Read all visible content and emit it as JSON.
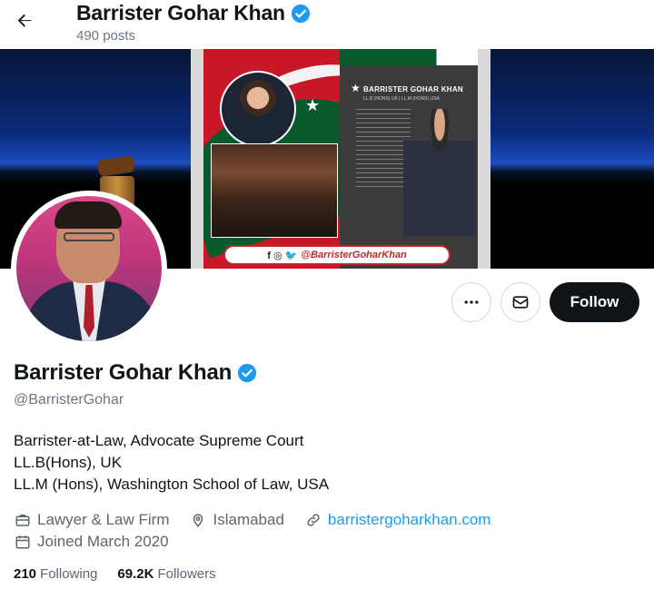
{
  "header": {
    "name": "Barrister Gohar Khan",
    "posts": "490 posts"
  },
  "banner": {
    "magazine_title": "BARRISTER GOHAR KHAN",
    "magazine_subtitle": "LL.B (HONS) UK | LL.M (HONS) USA",
    "handle_pill": "@BarristerGoharKhan"
  },
  "actions": {
    "more_label": "•••",
    "follow_label": "Follow"
  },
  "profile": {
    "name": "Barrister Gohar Khan",
    "handle": "@BarristerGohar",
    "bio": [
      "Barrister-at-Law, Advocate Supreme Court",
      "LL.B(Hons), UK",
      "LL.M (Hons), Washington School of Law, USA"
    ],
    "category": "Lawyer & Law Firm",
    "location": "Islamabad",
    "website": "barristergoharkhan.com",
    "joined": "Joined March 2020",
    "following_count": "210",
    "following_label": "Following",
    "followers_count": "69.2K",
    "followers_label": "Followers"
  },
  "colors": {
    "accent": "#1d9bf0",
    "text_primary": "#0f1419",
    "text_secondary": "#5b6670",
    "follow_button": "#0f1419"
  },
  "icons": {
    "back": "arrow-left-icon",
    "verified": "verified-badge-icon",
    "more": "more-icon",
    "message": "mail-icon",
    "category": "briefcase-icon",
    "location": "location-pin-icon",
    "website": "link-icon",
    "joined": "calendar-icon"
  }
}
